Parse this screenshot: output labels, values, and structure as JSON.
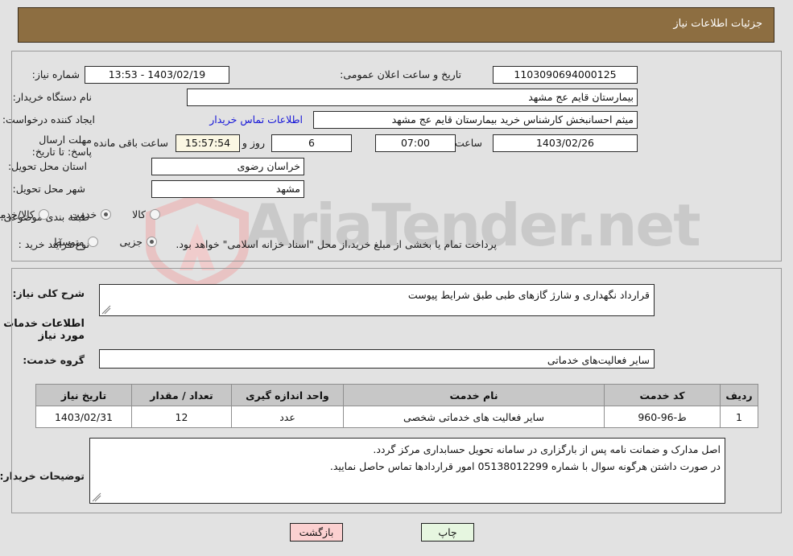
{
  "header": {
    "title": "جزئیات اطلاعات نیاز"
  },
  "watermark": {
    "text": "AriaTender.net"
  },
  "form": {
    "need_number_label": "شماره نیاز:",
    "need_number_value": "1103090694000125",
    "announce_datetime_label": "تاریخ و ساعت اعلان عمومی:",
    "announce_datetime_value": "1403/02/19 - 13:53",
    "buyer_org_label": "نام دستگاه خریدار:",
    "buyer_org_value": "بیمارستان قایم  عج  مشهد",
    "requester_label": "ایجاد کننده درخواست:",
    "requester_value": "میثم احسانبخش کارشناس خرید بیمارستان قایم  عج  مشهد",
    "contact_link": "اطلاعات تماس خریدار",
    "deadline_label": "مهلت ارسال پاسخ: تا تاریخ:",
    "deadline_date": "1403/02/26",
    "hour_label": "ساعت",
    "deadline_time": "07:00",
    "days_remaining": "6",
    "days_label": "روز و",
    "time_remaining": "15:57:54",
    "remaining_suffix": "ساعت باقی مانده",
    "province_label": "استان محل تحویل:",
    "province_value": "خراسان رضوی",
    "city_label": "شهر محل تحویل:",
    "city_value": "مشهد",
    "category_label": "طبقه بندی موضوعی:",
    "category_options": [
      {
        "label": "کالا",
        "selected": false
      },
      {
        "label": "خدمت",
        "selected": true
      },
      {
        "label": "کالا/خدمت",
        "selected": false
      }
    ],
    "process_label": "نوع فرآیند خرید :",
    "process_options": [
      {
        "label": "جزیی",
        "selected": true
      },
      {
        "label": "متوسط",
        "selected": false
      }
    ],
    "process_note": "پرداخت تمام یا بخشی از مبلغ خرید،از محل \"اسناد خزانه اسلامی\" خواهد بود."
  },
  "body": {
    "summary_label": "شرح کلی نیاز:",
    "summary_value": "قرارداد نگهداری و شارژ گازهای طبی طبق شرایط پیوست",
    "services_heading": "اطلاعات خدمات مورد نیاز",
    "service_group_label": "گروه خدمت:",
    "service_group_value": "سایر فعالیت‌های خدماتی",
    "buyer_notes_label": "توضیحات خریدار:",
    "buyer_notes_line1": "اصل مدارک و ضمانت نامه پس از بارگزاری در سامانه تحویل حسابداری مرکز گردد.",
    "buyer_notes_line2": "در صورت داشتن هرگونه سوال با شماره 05138012299 امور قراردادها تماس حاصل نمایید."
  },
  "table": {
    "columns": [
      "ردیف",
      "کد خدمت",
      "نام خدمت",
      "واحد اندازه گیری",
      "تعداد / مقدار",
      "تاریخ نیاز"
    ],
    "rows": [
      {
        "index": "1",
        "code": "ط-96-960",
        "name": "سایر فعالیت های خدماتی شخصی",
        "unit": "عدد",
        "quantity": "12",
        "need_date": "1403/02/31"
      }
    ]
  },
  "buttons": {
    "back": "بازگشت",
    "print": "چاپ"
  },
  "colors": {
    "header_brown": "#8d6e41",
    "page_background": "#e2e2e2",
    "link_blue": "#1616d8",
    "back_button": "#fbd0d0",
    "print_button": "#e6f6e0",
    "table_header": "#c7c7c7",
    "cream_field": "#fbf7e3"
  }
}
